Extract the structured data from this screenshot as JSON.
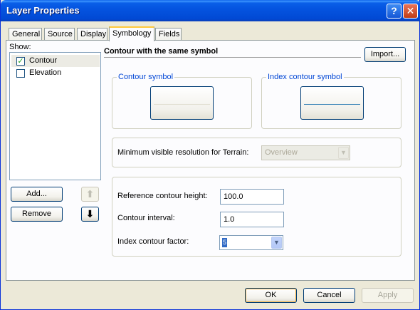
{
  "window": {
    "title": "Layer Properties",
    "help_label": "?",
    "close_label": "✕"
  },
  "tabs": [
    {
      "label": "General"
    },
    {
      "label": "Source"
    },
    {
      "label": "Display"
    },
    {
      "label": "Symbology",
      "active": true
    },
    {
      "label": "Fields"
    }
  ],
  "show": {
    "label": "Show:",
    "items": [
      {
        "label": "Contour",
        "checked": true,
        "selected": true
      },
      {
        "label": "Elevation",
        "checked": false,
        "selected": false
      }
    ],
    "add_button": "Add...",
    "remove_button": "Remove",
    "up_icon": "arrow-up-icon",
    "down_icon": "arrow-down-icon"
  },
  "symbology": {
    "heading": "Contour with the same symbol",
    "import_button": "Import...",
    "contour_symbol": {
      "title": "Contour symbol",
      "line_color": "#e2dfd2"
    },
    "index_contour_symbol": {
      "title": "Index contour symbol",
      "line_color": "#3d86b8"
    },
    "min_resolution": {
      "label": "Minimum visible resolution for Terrain:",
      "value": "Overview",
      "enabled": false
    },
    "reference_height": {
      "label": "Reference contour height:",
      "value": "100.0"
    },
    "contour_interval": {
      "label": "Contour interval:",
      "value": "1.0"
    },
    "index_factor": {
      "label": "Index contour factor:",
      "value": "5"
    }
  },
  "footer": {
    "ok": "OK",
    "cancel": "Cancel",
    "apply": "Apply"
  },
  "colors": {
    "title_bar": "#0554e0",
    "group_title": "#0046d5",
    "selection": "#316ac5"
  }
}
